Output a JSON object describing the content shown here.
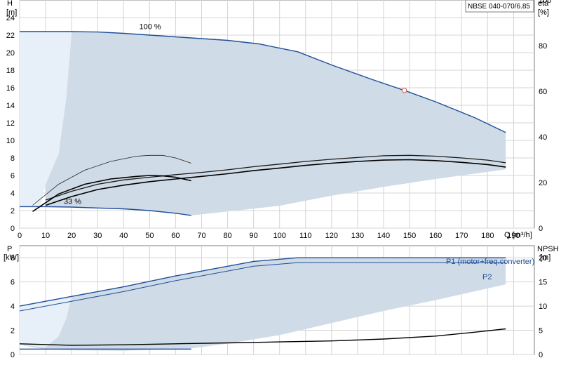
{
  "model_label": "NBSE 040-070/6.85",
  "chart_data": [
    {
      "type": "line",
      "name": "head-efficiency",
      "x_label": "Q [m³/h]",
      "y_label_left": "H",
      "y_unit_left": "[m]",
      "y_label_right": "eta",
      "y_unit_right": "[%]",
      "x_ticks": [
        0,
        10,
        20,
        30,
        40,
        50,
        60,
        70,
        80,
        90,
        100,
        110,
        120,
        130,
        140,
        150,
        160,
        170,
        180,
        190
      ],
      "y_ticks_left": [
        0,
        2,
        4,
        6,
        8,
        10,
        12,
        14,
        16,
        18,
        20,
        22,
        24
      ],
      "y_ticks_right": [
        0,
        20,
        40,
        60,
        80,
        100
      ],
      "xlim": [
        0,
        198
      ],
      "ylim_left": [
        0,
        26
      ],
      "ylim_right": [
        0,
        100
      ],
      "grid": true,
      "region_shading": true,
      "annotations": [
        {
          "text": "100 %",
          "x": 46,
          "y": 23.0
        },
        {
          "text": "33 %",
          "x": 17,
          "y": 3.1
        }
      ],
      "series": [
        {
          "id": "h100",
          "x": [
            0,
            20,
            30,
            40,
            50,
            60,
            70,
            80,
            92,
            107,
            120,
            135,
            148,
            160,
            175,
            187
          ],
          "y": [
            22.4,
            22.4,
            22.35,
            22.2,
            22.0,
            21.8,
            21.6,
            21.4,
            21.0,
            20.1,
            18.6,
            17.0,
            15.7,
            14.4,
            12.6,
            10.9
          ]
        },
        {
          "id": "h33",
          "x": [
            0,
            10,
            20,
            30,
            40,
            50,
            60,
            66
          ],
          "y": [
            2.45,
            2.45,
            2.4,
            2.3,
            2.2,
            2.0,
            1.7,
            1.45
          ]
        },
        {
          "id": "eta_upper",
          "x": [
            10,
            20,
            30,
            40,
            50,
            60,
            70,
            80,
            90,
            100,
            110,
            120,
            130,
            140,
            150,
            160,
            170,
            180,
            187
          ],
          "y": [
            3.2,
            4.2,
            5.0,
            5.5,
            5.8,
            6.1,
            6.35,
            6.65,
            7.0,
            7.3,
            7.6,
            7.85,
            8.05,
            8.25,
            8.3,
            8.2,
            8.0,
            7.75,
            7.45
          ]
        },
        {
          "id": "eta_lower",
          "x": [
            10,
            20,
            30,
            40,
            50,
            60,
            70,
            80,
            90,
            100,
            110,
            120,
            130,
            140,
            150,
            160,
            170,
            180,
            187
          ],
          "y": [
            2.6,
            3.6,
            4.4,
            4.9,
            5.3,
            5.6,
            5.9,
            6.2,
            6.55,
            6.85,
            7.15,
            7.4,
            7.6,
            7.75,
            7.8,
            7.7,
            7.5,
            7.25,
            6.95
          ]
        },
        {
          "id": "small_upper",
          "x": [
            5,
            15,
            25,
            35,
            45,
            50,
            55,
            60,
            66
          ],
          "y": [
            2.6,
            5.0,
            6.6,
            7.6,
            8.2,
            8.3,
            8.3,
            8.0,
            7.4
          ]
        },
        {
          "id": "small_lower",
          "x": [
            5,
            15,
            25,
            35,
            45,
            50,
            55,
            60,
            66
          ],
          "y": [
            1.9,
            3.9,
            5.0,
            5.6,
            5.9,
            6.0,
            5.95,
            5.8,
            5.4
          ]
        },
        {
          "id": "marker",
          "x": [
            148
          ],
          "y": [
            15.7
          ]
        }
      ]
    },
    {
      "type": "line",
      "name": "power-npsh",
      "y_label_left": "P",
      "y_unit_left": "[kW]",
      "y_label_right": "NPSH",
      "y_unit_right": "[m]",
      "y_ticks_left": [
        0,
        2,
        4,
        6,
        8
      ],
      "y_ticks_right": [
        0,
        5,
        10,
        15,
        20
      ],
      "ylim_left": [
        0,
        9
      ],
      "ylim_right": [
        0,
        22.5
      ],
      "grid": true,
      "series": [
        {
          "id": "p1",
          "name": "P1 (motor+freq.converter)",
          "x": [
            0,
            20,
            40,
            60,
            90,
            107,
            140,
            187
          ],
          "y": [
            4.0,
            4.8,
            5.6,
            6.5,
            7.7,
            8.0,
            8.0,
            8.0
          ]
        },
        {
          "id": "p2",
          "name": "P2",
          "x": [
            0,
            20,
            40,
            60,
            90,
            107,
            140,
            187
          ],
          "y": [
            3.6,
            4.4,
            5.2,
            6.1,
            7.3,
            7.6,
            7.6,
            7.6
          ]
        },
        {
          "id": "npsh",
          "x": [
            0,
            20,
            40,
            60,
            80,
            100,
            120,
            140,
            160,
            175,
            187
          ],
          "y": [
            2.2,
            1.9,
            2.0,
            2.2,
            2.4,
            2.6,
            2.8,
            3.2,
            3.8,
            4.6,
            5.3
          ]
        },
        {
          "id": "p_low",
          "x": [
            0,
            66
          ],
          "y": [
            0.45,
            0.45
          ]
        }
      ]
    }
  ]
}
